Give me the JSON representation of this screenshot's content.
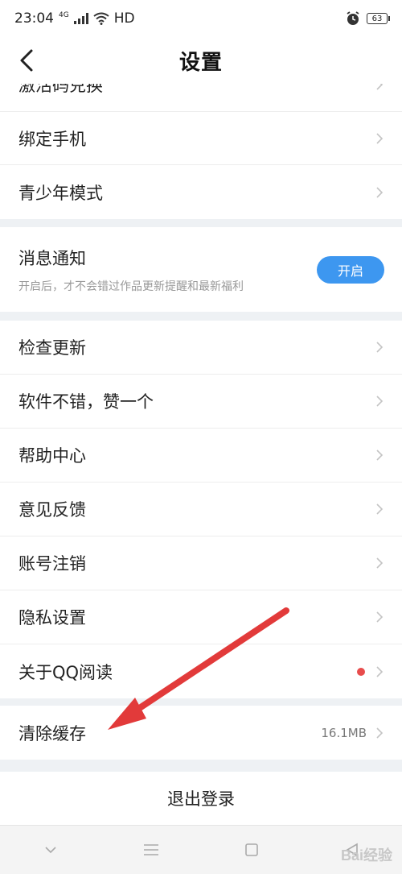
{
  "status": {
    "time": "23:04",
    "net_tag": "4G",
    "hd": "HD",
    "battery": "63"
  },
  "header": {
    "title": "设置"
  },
  "partial_row": {
    "label": "激活码兑换"
  },
  "group1": [
    {
      "label": "绑定手机"
    },
    {
      "label": "青少年模式"
    }
  ],
  "notification": {
    "title": "消息通知",
    "subtitle": "开启后，才不会错过作品更新提醒和最新福利",
    "button": "开启"
  },
  "group2": [
    {
      "label": "检查更新"
    },
    {
      "label": "软件不错，赞一个"
    },
    {
      "label": "帮助中心"
    },
    {
      "label": "意见反馈"
    },
    {
      "label": "账号注销"
    },
    {
      "label": "隐私设置"
    },
    {
      "label": "关于QQ阅读"
    }
  ],
  "cache": {
    "label": "清除缓存",
    "value": "16.1MB"
  },
  "logout": {
    "label": "退出登录"
  },
  "watermark": "Bai经验",
  "colors": {
    "accent": "#3d97f0",
    "dot": "#e84c4c",
    "arrow": "#e23a3a"
  }
}
